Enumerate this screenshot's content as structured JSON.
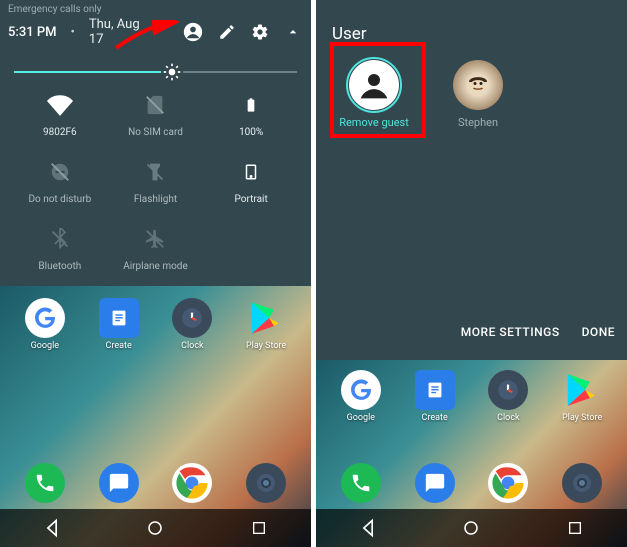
{
  "left": {
    "status": "Emergency calls only",
    "time": "5:31 PM",
    "date": "Thu, Aug 17",
    "brightness": {
      "percent": 56
    },
    "tiles": [
      {
        "id": "wifi",
        "label": "9802F6",
        "active": true
      },
      {
        "id": "sim",
        "label": "No SIM card",
        "active": false
      },
      {
        "id": "battery",
        "label": "100%",
        "active": true
      },
      {
        "id": "dnd",
        "label": "Do not disturb",
        "active": false
      },
      {
        "id": "flashlight",
        "label": "Flashlight",
        "active": false
      },
      {
        "id": "portrait",
        "label": "Portrait",
        "active": true
      },
      {
        "id": "bluetooth",
        "label": "Bluetooth",
        "active": false
      },
      {
        "id": "airplane",
        "label": "Airplane mode",
        "active": false
      }
    ],
    "apps_row1": [
      {
        "id": "google",
        "label": "Google"
      },
      {
        "id": "create",
        "label": "Create"
      },
      {
        "id": "clock",
        "label": "Clock"
      },
      {
        "id": "playstore",
        "label": "Play Store"
      }
    ],
    "apps_row2": [
      {
        "id": "phone",
        "label": ""
      },
      {
        "id": "messages",
        "label": ""
      },
      {
        "id": "chrome",
        "label": ""
      },
      {
        "id": "camera",
        "label": ""
      }
    ]
  },
  "right": {
    "title": "User",
    "users": [
      {
        "id": "guest",
        "label": "Remove guest",
        "selected": true
      },
      {
        "id": "stephen",
        "label": "Stephen",
        "selected": false
      }
    ],
    "more_settings": "MORE SETTINGS",
    "done": "DONE"
  },
  "colors": {
    "accent": "#4fe4de",
    "panel": "#33474e",
    "highlight": "#ff0000"
  }
}
